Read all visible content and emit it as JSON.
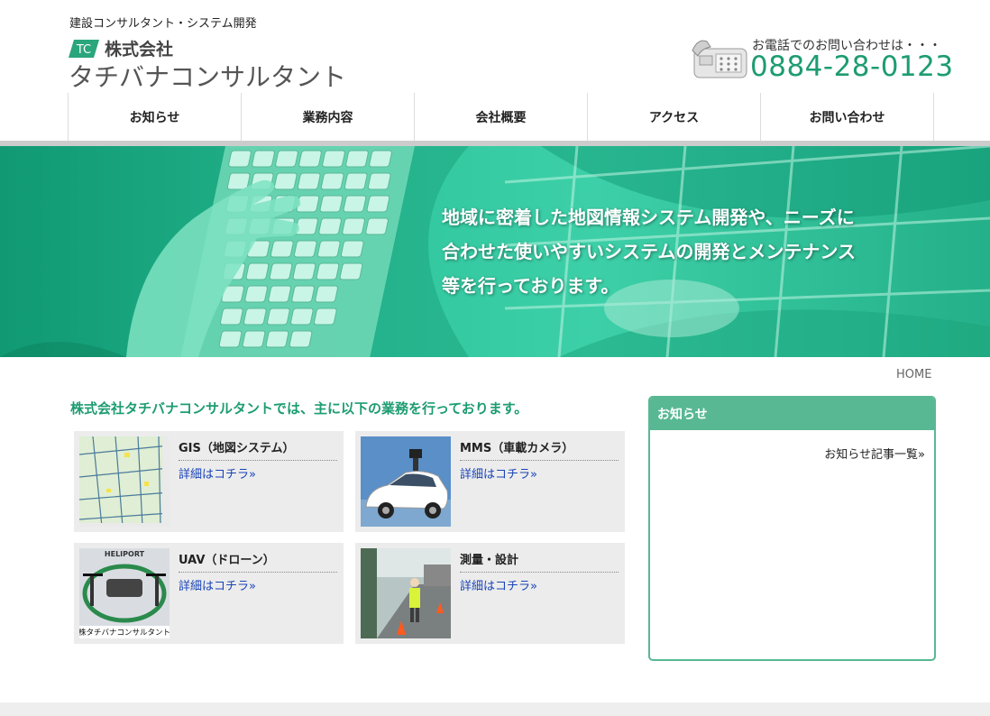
{
  "header": {
    "tagline": "建設コンサルタント・システム開発",
    "logo_mark": "TC",
    "company_prefix": "株式会社",
    "company_name": "タチバナコンサルタント",
    "phone_label": "お電話でのお問い合わせは・・・",
    "phone_number": "0884-28-0123"
  },
  "nav": {
    "items": [
      {
        "label": "お知らせ"
      },
      {
        "label": "業務内容"
      },
      {
        "label": "会社概要"
      },
      {
        "label": "アクセス"
      },
      {
        "label": "お問い合わせ"
      }
    ]
  },
  "hero": {
    "lines": [
      "地域に密着した地図情報システム開発や、ニーズに",
      "合わせた使いやすいシステムの開発とメンテナンス",
      "等を行っております。"
    ]
  },
  "breadcrumb": "HOME",
  "main": {
    "intro": "株式会社タチバナコンサルタントでは、主に以下の業務を行っております。",
    "services": [
      {
        "title": "GIS（地図システム）",
        "link": "詳細はコチラ»",
        "icon": "map-thumbnail"
      },
      {
        "title": "MMS（車載カメラ）",
        "link": "詳細はコチラ»",
        "icon": "car-thumbnail"
      },
      {
        "title": "UAV（ドローン）",
        "link": "詳細はコチラ»",
        "icon": "drone-thumbnail",
        "thumb_caption": "株タチバナコンサルタント",
        "thumb_sign": "HELIPORT"
      },
      {
        "title": "測量・設計",
        "link": "詳細はコチラ»",
        "icon": "survey-thumbnail"
      }
    ]
  },
  "sidebar": {
    "heading": "お知らせ",
    "link": "お知らせ記事一覧»"
  },
  "colors": {
    "accent": "#1d9c72",
    "sidebar": "#58b893",
    "link": "#1a44b8"
  }
}
